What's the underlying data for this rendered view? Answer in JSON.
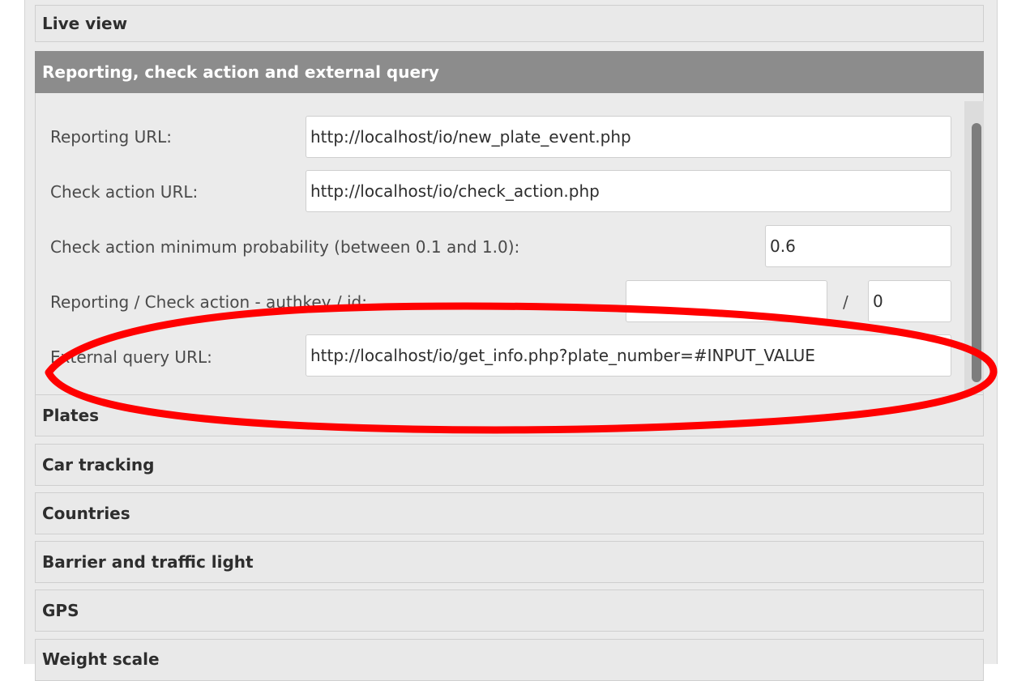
{
  "accordion": {
    "live_view": "Live view",
    "reporting": "Reporting, check action and external query",
    "plates": "Plates",
    "car_tracking": "Car tracking",
    "countries": "Countries",
    "barrier": "Barrier and traffic light",
    "gps": "GPS",
    "weight_scale": "Weight scale"
  },
  "form": {
    "reporting_url_label": "Reporting URL:",
    "reporting_url_value": "http://localhost/io/new_plate_event.php",
    "check_action_url_label": "Check action URL:",
    "check_action_url_value": "http://localhost/io/check_action.php",
    "min_probability_label": "Check action minimum probability (between 0.1 and 1.0):",
    "min_probability_value": "0.6",
    "authkey_label": "Reporting / Check action - authkey / id:",
    "authkey_value": "",
    "id_separator": "/",
    "id_value": "0",
    "external_query_label": "External query URL:",
    "external_query_value": "http://localhost/io/get_info.php?plate_number=#INPUT_VALUE"
  },
  "colors": {
    "active_header": "#8c8c8c",
    "annotation_stroke": "#ff0000"
  }
}
